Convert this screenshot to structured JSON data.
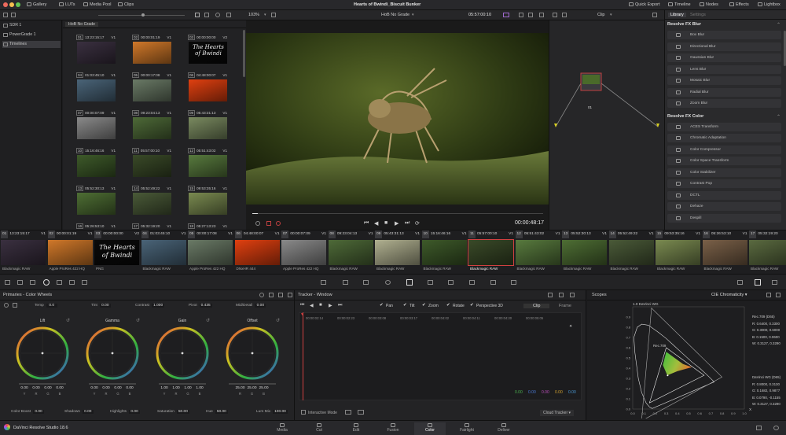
{
  "app": {
    "window_title": "Hearts of Bwindi_Biscuit Bunker",
    "product": "DaVinci Resolve Studio 18.6"
  },
  "topbar": {
    "left": [
      "Gallery",
      "LUTs",
      "Media Pool",
      "Clips"
    ],
    "right": [
      "Quick Export",
      "Timeline",
      "Nodes",
      "Effects",
      "Lightbox"
    ]
  },
  "bar2": {
    "zoom": "103%",
    "grade_label": "HoB No Grade",
    "timecode": "05:57:00:10",
    "mode": "Clip"
  },
  "tree": {
    "items": [
      "SDR 1",
      "PowerGrade 1",
      "Timelines"
    ]
  },
  "media": {
    "tab": "HoB No Grade",
    "thumbs": [
      {
        "n": "01",
        "tc": "13:23:15:17",
        "v": "V1",
        "c": "#3a3040"
      },
      {
        "n": "02",
        "tc": "00:00:01:19",
        "v": "V1",
        "c": "#d0782a"
      },
      {
        "n": "03",
        "tc": "00:00:00:00",
        "v": "V2",
        "c": "#0a0a0a",
        "title": "The Hearts of Bwindi"
      },
      {
        "n": "04",
        "tc": "01:03:45:10",
        "v": "V1",
        "c": "#4a6478"
      },
      {
        "n": "05",
        "tc": "00:00:17:08",
        "v": "V1",
        "c": "#6a7a66"
      },
      {
        "n": "06",
        "tc": "04:48:00:07",
        "v": "V1",
        "c": "#e04010"
      },
      {
        "n": "07",
        "tc": "00:00:07:09",
        "v": "V1",
        "c": "#8a8a8a"
      },
      {
        "n": "08",
        "tc": "09:23:04:13",
        "v": "V1",
        "c": "#4e6a38"
      },
      {
        "n": "09",
        "tc": "05:43:31:13",
        "v": "V1",
        "c": "#7a8a60"
      },
      {
        "n": "10",
        "tc": "15:16:46:16",
        "v": "V1",
        "c": "#3e5a2a"
      },
      {
        "n": "11",
        "tc": "05:57:00:10",
        "v": "V1",
        "c": "#3a4a28"
      },
      {
        "n": "12",
        "tc": "05:51:43:02",
        "v": "V1",
        "c": "#587a3e"
      },
      {
        "n": "13",
        "tc": "05:52:30:13",
        "v": "V1",
        "c": "#4e6e34"
      },
      {
        "n": "14",
        "tc": "05:52:49:22",
        "v": "V1",
        "c": "#4a5a38"
      },
      {
        "n": "15",
        "tc": "09:53:35:16",
        "v": "V1",
        "c": "#7a8a50"
      },
      {
        "n": "16",
        "tc": "05:26:53:10",
        "v": "V1",
        "c": "#6a6a5a"
      },
      {
        "n": "17",
        "tc": "05:32:19:20",
        "v": "V1",
        "c": "#5a6a40"
      },
      {
        "n": "18",
        "tc": "05:27:13:23",
        "v": "V1",
        "c": "#4a5a34"
      }
    ]
  },
  "viewer": {
    "timecode": "00:00:48:17",
    "progress": 0.02
  },
  "nodes": {
    "node_label": "01"
  },
  "effects": {
    "tabs": [
      "Library",
      "Settings"
    ],
    "sections": [
      {
        "title": "Resolve FX Blur",
        "items": [
          "Box Blur",
          "Directional Blur",
          "Gaussian Blur",
          "Lens Blur",
          "Mosaic Blur",
          "Radial Blur",
          "Zoom Blur"
        ]
      },
      {
        "title": "Resolve FX Color",
        "items": [
          "ACES Transform",
          "Chromatic Adaptation",
          "Color Compressor",
          "Color Space Transform",
          "Color Stabilizer",
          "Contrast Pop",
          "DCTL",
          "Dehaze",
          "Despill"
        ]
      }
    ]
  },
  "strip": {
    "clips": [
      {
        "n": "01",
        "tc": "13:23:15:17",
        "v": "V1",
        "c": "#3a3040",
        "codec": "Blackmagic RAW"
      },
      {
        "n": "02",
        "tc": "00:00:01:19",
        "v": "V1",
        "c": "#d0782a",
        "codec": "Apple ProRes 422 HQ"
      },
      {
        "n": "03",
        "tc": "00:00:00:00",
        "v": "V2",
        "c": "#0a0a0a",
        "codec": "PNG",
        "title": "The Hearts of Bwindi"
      },
      {
        "n": "04",
        "tc": "01:03:45:10",
        "v": "V1",
        "c": "#4a6478",
        "codec": "Blackmagic RAW"
      },
      {
        "n": "05",
        "tc": "00:00:17:08",
        "v": "V1",
        "c": "#6a7a66",
        "codec": "Apple ProRes 422 HQ"
      },
      {
        "n": "06",
        "tc": "04:48:00:07",
        "v": "V1",
        "c": "#e04010",
        "codec": "DNxHR 444"
      },
      {
        "n": "07",
        "tc": "00:00:07:09",
        "v": "V1",
        "c": "#8a8a8a",
        "codec": "Apple ProRes 422 HQ"
      },
      {
        "n": "08",
        "tc": "09:23:04:13",
        "v": "V1",
        "c": "#4e6a38",
        "codec": "Blackmagic RAW"
      },
      {
        "n": "09",
        "tc": "05:43:31:13",
        "v": "V1",
        "c": "#b0b090",
        "codec": "Blackmagic RAW"
      },
      {
        "n": "10",
        "tc": "15:16:46:16",
        "v": "V1",
        "c": "#3e5a2a",
        "codec": "Blackmagic RAW"
      },
      {
        "n": "11",
        "tc": "05:57:00:10",
        "v": "V1",
        "c": "#3a4a28",
        "codec": "Blackmagic RAW",
        "selected": true
      },
      {
        "n": "12",
        "tc": "05:51:43:02",
        "v": "V1",
        "c": "#587a3e",
        "codec": "Blackmagic RAW"
      },
      {
        "n": "13",
        "tc": "05:52:30:13",
        "v": "V1",
        "c": "#4e6e34",
        "codec": "Blackmagic RAW"
      },
      {
        "n": "14",
        "tc": "05:52:49:22",
        "v": "V1",
        "c": "#4a5a38",
        "codec": "Blackmagic RAW"
      },
      {
        "n": "15",
        "tc": "09:53:35:16",
        "v": "V1",
        "c": "#7a8a50",
        "codec": "Blackmagic RAW"
      },
      {
        "n": "16",
        "tc": "05:26:53:10",
        "v": "V1",
        "c": "#7a6048",
        "codec": "Blackmagic RAW"
      },
      {
        "n": "17",
        "tc": "05:32:19:20",
        "v": "V1",
        "c": "#5a6a40",
        "codec": "Blackmagic RAW"
      }
    ]
  },
  "wheels": {
    "title": "Primaries - Color Wheels",
    "top_params": [
      {
        "label": "Temp",
        "value": "0.0"
      },
      {
        "label": "Tint",
        "value": "0.00"
      },
      {
        "label": "Contrast",
        "value": "1.000"
      },
      {
        "label": "Pivot",
        "value": "0.435"
      },
      {
        "label": "Mid/Detail",
        "value": "0.00"
      }
    ],
    "wheel_list": [
      {
        "name": "Lift",
        "vals": [
          "0.00",
          "0.00",
          "0.00",
          "0.00"
        ]
      },
      {
        "name": "Gamma",
        "vals": [
          "0.00",
          "0.00",
          "0.00",
          "0.00"
        ]
      },
      {
        "name": "Gain",
        "vals": [
          "1.00",
          "1.00",
          "1.00",
          "1.00"
        ]
      },
      {
        "name": "Offset",
        "vals": [
          "25.00",
          "25.00",
          "25.00"
        ]
      }
    ],
    "channel_labels": [
      "Y",
      "R",
      "G",
      "B"
    ],
    "bottom_params": [
      {
        "label": "Color Boost",
        "value": "0.00"
      },
      {
        "label": "Shadows",
        "value": "0.00"
      },
      {
        "label": "Highlights",
        "value": "0.00"
      },
      {
        "label": "Saturation",
        "value": "50.00"
      },
      {
        "label": "Hue",
        "value": "50.00"
      },
      {
        "label": "Lum Mix",
        "value": "100.00"
      }
    ]
  },
  "tracker": {
    "title": "Tracker - Window",
    "checks": [
      "Pan",
      "Tilt",
      "Zoom",
      "Rotate",
      "Perspective 3D"
    ],
    "tabs": [
      "Clip",
      "Frame"
    ],
    "ruler": [
      "00:00:02:14",
      "00:00:02:23",
      "00:00:03:08",
      "00:00:03:17",
      "00:00:04:02",
      "00:00:04:11",
      "00:00:04:20",
      "00:00:05:05"
    ],
    "readout": [
      {
        "v": "0.00",
        "c": "#4caf50"
      },
      {
        "v": "0.00",
        "c": "#4a7ad6"
      },
      {
        "v": "0.00",
        "c": "#c050c0"
      },
      {
        "v": "0.00",
        "c": "#d0a030"
      },
      {
        "v": "0.00",
        "c": "#4a9ad6"
      }
    ],
    "interactive": "Interactive Mode",
    "cloud": "Cloud Tracker"
  },
  "scopes": {
    "title": "Scopes",
    "mode": "CIE Chromaticity",
    "gamut_label": "1.0 DaVinci WG",
    "rec_label": "Rec.709",
    "rec_stats": {
      "title": "Rec.709 (D65)",
      "r": "R: 0.6400, 0.3300",
      "g": "G: 0.3000, 0.6000",
      "b": "B: 0.1500, 0.0600",
      "w": "W: 0.3127, 0.3290"
    },
    "dwg_stats": {
      "title": "DaVinci WG (D65)",
      "r": "R: 0.8000, 0.3130",
      "g": "G: 0.1682, 0.9877",
      "b": "B: 0.0790, -0.1155",
      "w": "W: 0.3127, 0.3290"
    },
    "y_ticks": [
      "0.9",
      "0.8",
      "0.7",
      "0.6",
      "0.5",
      "0.4",
      "0.3",
      "0.2",
      "0.1",
      "0.0"
    ],
    "x_ticks": [
      "0.0",
      "0.1",
      "0.2",
      "0.3",
      "0.4",
      "0.5",
      "0.6",
      "0.7",
      "0.8",
      "0.9",
      "1.0"
    ],
    "axis_x": "X"
  },
  "pages": [
    "Media",
    "Cut",
    "Edit",
    "Fusion",
    "Color",
    "Fairlight",
    "Deliver"
  ],
  "active_page": "Color"
}
